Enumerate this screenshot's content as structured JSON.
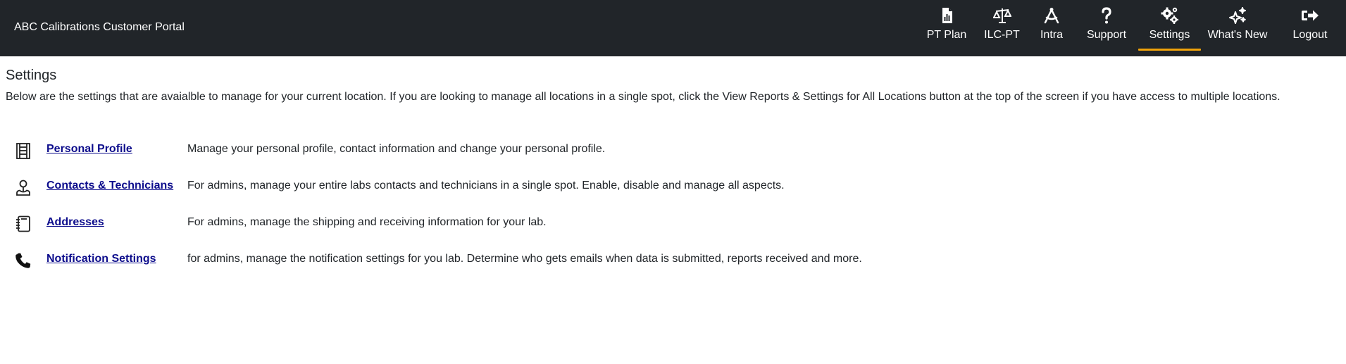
{
  "header": {
    "brand": "ABC Calibrations Customer Portal",
    "nav": [
      {
        "label": "PT Plan",
        "icon": "report-icon"
      },
      {
        "label": "ILC-PT",
        "icon": "scale-icon"
      },
      {
        "label": "Intra",
        "icon": "compass-icon"
      },
      {
        "label": "Support",
        "icon": "question-icon"
      },
      {
        "label": "Settings",
        "icon": "gears-icon",
        "active": true
      },
      {
        "label": "What's New",
        "icon": "sparkles-icon"
      },
      {
        "label": "Logout",
        "icon": "logout-icon"
      }
    ],
    "accent_color": "#f0a30a",
    "background_color": "#212529"
  },
  "main": {
    "title": "Settings",
    "intro": "Below are the settings that are avaialble to manage for your current location. If you are looking to manage all locations in a single spot, click the View Reports & Settings for All Locations button at the top of the screen if you have access to multiple locations.",
    "items": [
      {
        "icon": "ledger-icon",
        "label": "Personal Profile",
        "description": "Manage your personal profile, contact information and change your personal profile."
      },
      {
        "icon": "person-icon",
        "label": "Contacts & Technicians",
        "description": "For admins, manage your entire labs contacts and technicians in a single spot. Enable, disable and manage all aspects."
      },
      {
        "icon": "address-book-icon",
        "label": "Addresses",
        "description": "For admins, manage the shipping and receiving information for your lab."
      },
      {
        "icon": "phone-icon",
        "label": "Notification Settings",
        "description": "for admins, manage the notification settings for you lab. Determine who gets emails when data is submitted, reports received and more."
      }
    ],
    "link_color": "#0d0d8c"
  }
}
